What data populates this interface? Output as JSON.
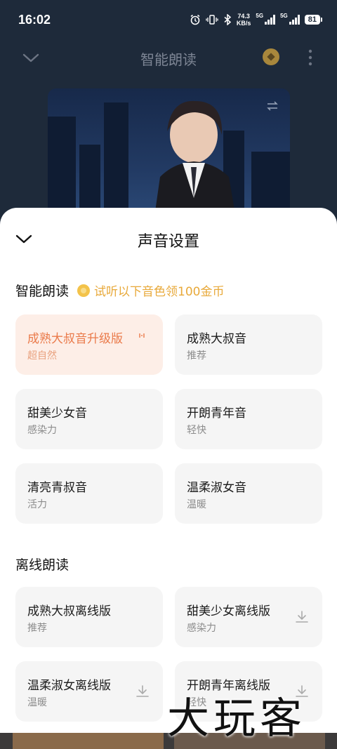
{
  "status_bar": {
    "time": "16:02",
    "net_speed_value": "74.3",
    "net_speed_unit": "KB/s",
    "sim1_label": "5G",
    "sim2_label": "5G",
    "battery": "81"
  },
  "header": {
    "title": "智能朗读"
  },
  "sheet": {
    "title": "声音设置",
    "smart_section": {
      "title": "智能朗读",
      "promo": "试听以下音色领100金币",
      "voices": [
        {
          "name": "成熟大叔音升级版",
          "desc": "超自然",
          "selected": true
        },
        {
          "name": "成熟大叔音",
          "desc": "推荐",
          "selected": false
        },
        {
          "name": "甜美少女音",
          "desc": "感染力",
          "selected": false
        },
        {
          "name": "开朗青年音",
          "desc": "轻快",
          "selected": false
        },
        {
          "name": "清亮青叔音",
          "desc": "活力",
          "selected": false
        },
        {
          "name": "温柔淑女音",
          "desc": "温暖",
          "selected": false
        }
      ]
    },
    "offline_section": {
      "title": "离线朗读",
      "voices": [
        {
          "name": "成熟大叔离线版",
          "desc": "推荐",
          "downloadable": false
        },
        {
          "name": "甜美少女离线版",
          "desc": "感染力",
          "downloadable": true
        },
        {
          "name": "温柔淑女离线版",
          "desc": "温暖",
          "downloadable": true
        },
        {
          "name": "开朗青年离线版",
          "desc": "轻快",
          "downloadable": true
        }
      ]
    }
  },
  "watermark": "大玩客",
  "colors": {
    "accent": "#ea7a4a",
    "selected_bg": "#fdeee7",
    "promo": "#e8a93a",
    "card_bg": "#f5f5f5"
  }
}
